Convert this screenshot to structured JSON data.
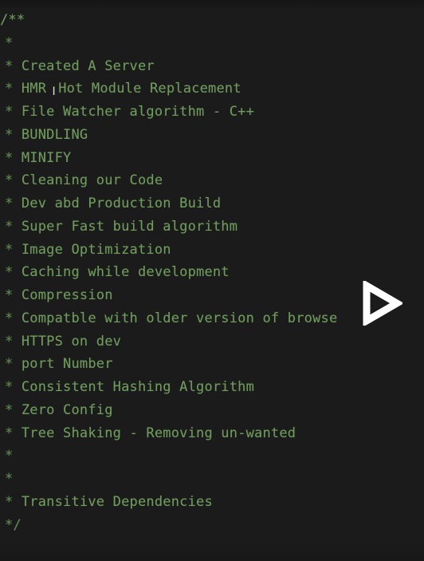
{
  "code": {
    "open": "/**",
    "lines": [
      "",
      "Created A Server",
      "HMR",
      "File Watcher algorithm - C++",
      "BUNDLING",
      "MINIFY",
      "Cleaning our Code",
      "Dev abd Production Build",
      "Super Fast build algorithm",
      "Image Optimization",
      "Caching while development",
      "Compression",
      "Compatble with older version of browse",
      "HTTPS on dev",
      "port Number",
      "Consistent Hashing Algorithm",
      "Zero Config",
      "Tree Shaking - Removing un-wanted",
      "",
      "",
      "Transitive Dependencies"
    ],
    "hmr_rest": "Hot Module Replacement",
    "star": "*",
    "close": "*/"
  },
  "colors": {
    "background": "#1b1b1b",
    "comment_text": "#6f9c5d"
  },
  "overlay": {
    "play_icon": "play-icon"
  }
}
